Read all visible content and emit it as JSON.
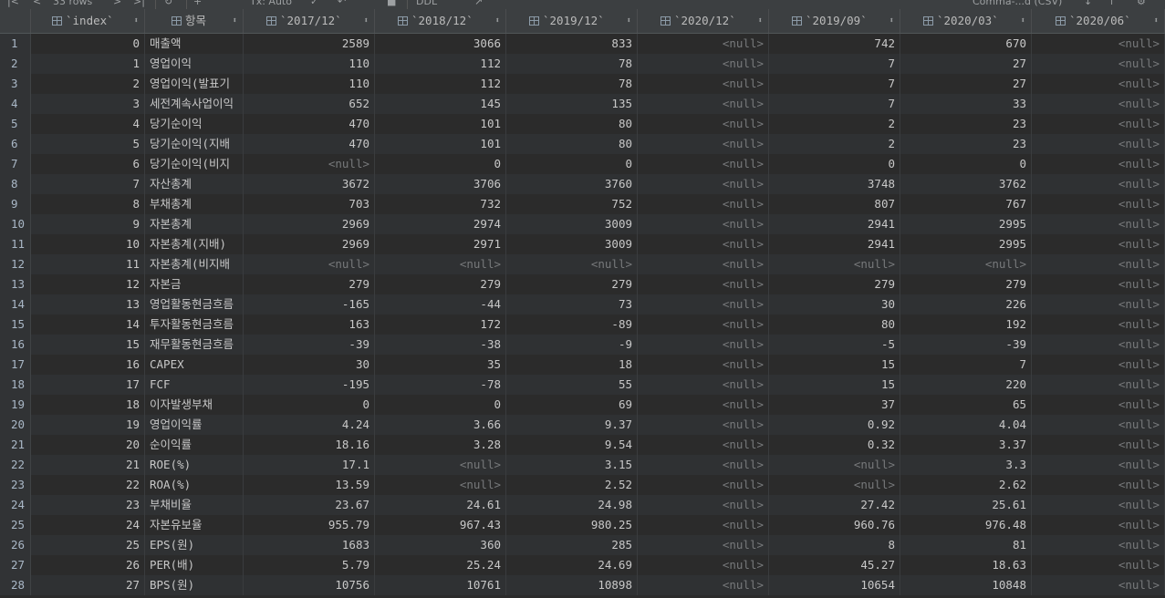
{
  "toolbar": {
    "rows_label": "33 rows",
    "tx_label": "Tx: Auto",
    "ddl_label": "DDL",
    "format_label": "Comma-...d (CSV)"
  },
  "columns": [
    "`index`",
    "항목",
    "`2017/12`",
    "`2018/12`",
    "`2019/12`",
    "`2020/12`",
    "`2019/09`",
    "`2020/03`",
    "`2020/06`"
  ],
  "null_text": "<null>",
  "rows": [
    {
      "n": "1",
      "index": "0",
      "item": "매출액",
      "v": [
        "2589",
        "3066",
        "833",
        null,
        "742",
        "670",
        null
      ]
    },
    {
      "n": "2",
      "index": "1",
      "item": "영업이익",
      "v": [
        "110",
        "112",
        "78",
        null,
        "7",
        "27",
        null
      ]
    },
    {
      "n": "3",
      "index": "2",
      "item": "영업이익(발표기",
      "v": [
        "110",
        "112",
        "78",
        null,
        "7",
        "27",
        null
      ]
    },
    {
      "n": "4",
      "index": "3",
      "item": "세전계속사업이익",
      "v": [
        "652",
        "145",
        "135",
        null,
        "7",
        "33",
        null
      ]
    },
    {
      "n": "5",
      "index": "4",
      "item": "당기순이익",
      "v": [
        "470",
        "101",
        "80",
        null,
        "2",
        "23",
        null
      ]
    },
    {
      "n": "6",
      "index": "5",
      "item": "당기순이익(지배",
      "v": [
        "470",
        "101",
        "80",
        null,
        "2",
        "23",
        null
      ]
    },
    {
      "n": "7",
      "index": "6",
      "item": "당기순이익(비지",
      "v": [
        null,
        "0",
        "0",
        null,
        "0",
        "0",
        null
      ]
    },
    {
      "n": "8",
      "index": "7",
      "item": "자산총계",
      "v": [
        "3672",
        "3706",
        "3760",
        null,
        "3748",
        "3762",
        null
      ]
    },
    {
      "n": "9",
      "index": "8",
      "item": "부채총계",
      "v": [
        "703",
        "732",
        "752",
        null,
        "807",
        "767",
        null
      ]
    },
    {
      "n": "10",
      "index": "9",
      "item": "자본총계",
      "v": [
        "2969",
        "2974",
        "3009",
        null,
        "2941",
        "2995",
        null
      ]
    },
    {
      "n": "11",
      "index": "10",
      "item": "자본총계(지배)",
      "v": [
        "2969",
        "2971",
        "3009",
        null,
        "2941",
        "2995",
        null
      ]
    },
    {
      "n": "12",
      "index": "11",
      "item": "자본총계(비지배",
      "v": [
        null,
        null,
        null,
        null,
        null,
        null,
        null
      ]
    },
    {
      "n": "13",
      "index": "12",
      "item": "자본금",
      "v": [
        "279",
        "279",
        "279",
        null,
        "279",
        "279",
        null
      ]
    },
    {
      "n": "14",
      "index": "13",
      "item": "영업활동현금흐름",
      "v": [
        "-165",
        "-44",
        "73",
        null,
        "30",
        "226",
        null
      ]
    },
    {
      "n": "15",
      "index": "14",
      "item": "투자활동현금흐름",
      "v": [
        "163",
        "172",
        "-89",
        null,
        "80",
        "192",
        null
      ]
    },
    {
      "n": "16",
      "index": "15",
      "item": "재무활동현금흐름",
      "v": [
        "-39",
        "-38",
        "-9",
        null,
        "-5",
        "-39",
        null
      ]
    },
    {
      "n": "17",
      "index": "16",
      "item": "CAPEX",
      "v": [
        "30",
        "35",
        "18",
        null,
        "15",
        "7",
        null
      ]
    },
    {
      "n": "18",
      "index": "17",
      "item": "FCF",
      "v": [
        "-195",
        "-78",
        "55",
        null,
        "15",
        "220",
        null
      ]
    },
    {
      "n": "19",
      "index": "18",
      "item": "이자발생부채",
      "v": [
        "0",
        "0",
        "69",
        null,
        "37",
        "65",
        null
      ]
    },
    {
      "n": "20",
      "index": "19",
      "item": "영업이익률",
      "v": [
        "4.24",
        "3.66",
        "9.37",
        null,
        "0.92",
        "4.04",
        null
      ]
    },
    {
      "n": "21",
      "index": "20",
      "item": "순이익률",
      "v": [
        "18.16",
        "3.28",
        "9.54",
        null,
        "0.32",
        "3.37",
        null
      ]
    },
    {
      "n": "22",
      "index": "21",
      "item": "ROE(%)",
      "v": [
        "17.1",
        null,
        "3.15",
        null,
        null,
        "3.3",
        null
      ]
    },
    {
      "n": "23",
      "index": "22",
      "item": "ROA(%)",
      "v": [
        "13.59",
        null,
        "2.52",
        null,
        null,
        "2.62",
        null
      ]
    },
    {
      "n": "24",
      "index": "23",
      "item": "부채비율",
      "v": [
        "23.67",
        "24.61",
        "24.98",
        null,
        "27.42",
        "25.61",
        null
      ]
    },
    {
      "n": "25",
      "index": "24",
      "item": "자본유보율",
      "v": [
        "955.79",
        "967.43",
        "980.25",
        null,
        "960.76",
        "976.48",
        null
      ]
    },
    {
      "n": "26",
      "index": "25",
      "item": "EPS(원)",
      "v": [
        "1683",
        "360",
        "285",
        null,
        "8",
        "81",
        null
      ]
    },
    {
      "n": "27",
      "index": "26",
      "item": "PER(배)",
      "v": [
        "5.79",
        "25.24",
        "24.69",
        null,
        "45.27",
        "18.63",
        null
      ]
    },
    {
      "n": "28",
      "index": "27",
      "item": "BPS(원)",
      "v": [
        "10756",
        "10761",
        "10898",
        null,
        "10654",
        "10848",
        null
      ]
    }
  ]
}
